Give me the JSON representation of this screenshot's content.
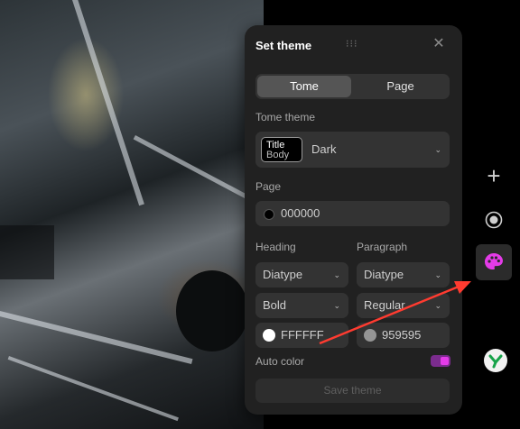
{
  "panel": {
    "title": "Set theme",
    "tabs": [
      {
        "label": "Tome",
        "active": true
      },
      {
        "label": "Page",
        "active": false
      }
    ],
    "tome_theme": {
      "label": "Tome theme",
      "swatch_title": "Title",
      "swatch_body": "Body",
      "value": "Dark"
    },
    "page": {
      "label": "Page",
      "color_value": "000000",
      "color": "#000000"
    },
    "heading": {
      "label": "Heading",
      "font": "Diatype",
      "weight": "Bold",
      "color_value": "FFFFFF",
      "color": "#FFFFFF"
    },
    "paragraph": {
      "label": "Paragraph",
      "font": "Diatype",
      "weight": "Regular",
      "color_value": "959595",
      "color": "#959595"
    },
    "auto_color": {
      "label": "Auto color",
      "enabled": true
    },
    "save_label": "Save theme"
  },
  "right_toolbar": {
    "icons": [
      "plus-icon",
      "record-icon",
      "palette-icon",
      "logo-icon"
    ],
    "palette_color": "#e43be8"
  },
  "colors": {
    "panel_bg": "#212121",
    "field_bg": "#333333",
    "accent": "#e43be8",
    "annotation_arrow": "#ff3b30"
  }
}
